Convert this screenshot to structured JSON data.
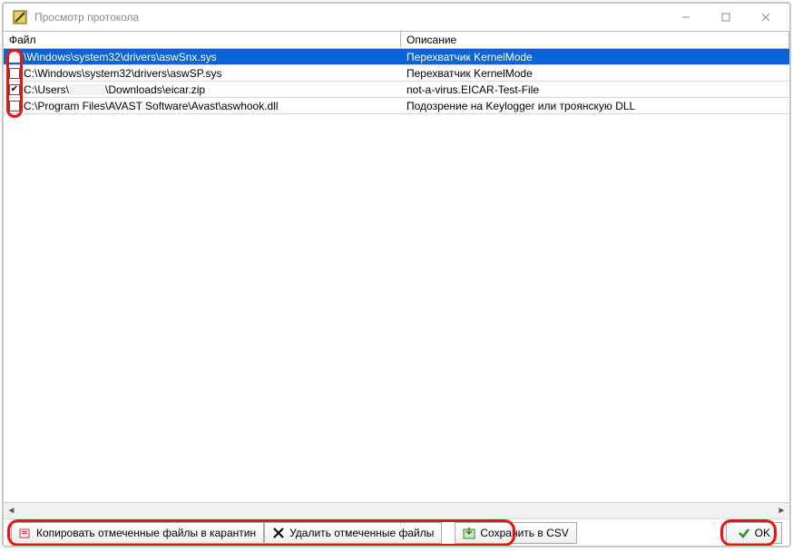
{
  "window": {
    "title": "Просмотр протокола"
  },
  "columns": {
    "file": "Файл",
    "desc": "Описание"
  },
  "rows": [
    {
      "checked": false,
      "selected": true,
      "file_prefix": "",
      "file_path": "\\Windows\\system32\\drivers\\aswSnx.sys",
      "desc": "Перехватчик KernelMode"
    },
    {
      "checked": false,
      "selected": false,
      "file_prefix": "C:",
      "file_path": "\\Windows\\system32\\drivers\\aswSP.sys",
      "desc": "Перехватчик KernelMode"
    },
    {
      "checked": true,
      "selected": false,
      "file_prefix": "C:",
      "file_mid_redacted": true,
      "file_path_a": "\\Users\\",
      "file_path_b": "\\Downloads\\eicar.zip",
      "desc": "not-a-virus.EICAR-Test-File"
    },
    {
      "checked": false,
      "selected": false,
      "file_prefix": "C:",
      "file_path": "\\Program Files\\AVAST Software\\Avast\\aswhook.dll",
      "desc": "Подозрение на Keylogger или троянскую DLL"
    }
  ],
  "buttons": {
    "quarantine": "Копировать отмеченные файлы в карантин",
    "delete": "Удалить отмеченные файлы",
    "save_csv": "Сохранить в CSV",
    "ok": "OK"
  }
}
